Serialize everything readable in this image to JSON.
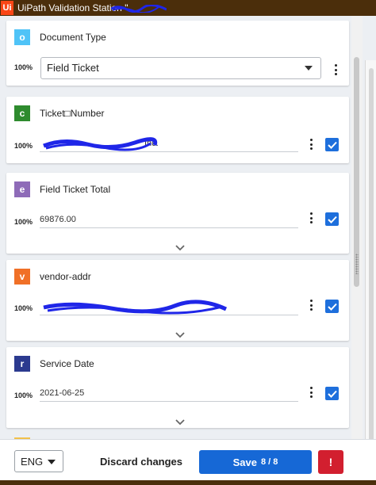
{
  "window": {
    "app_icon_text": "Ui",
    "title": "UiPath Validation Station \""
  },
  "fields": [
    {
      "badge": "o",
      "badge_color": "#4fc3f7",
      "name": "Document Type",
      "confidence": "100%",
      "value": "Field Ticket"
    },
    {
      "badge": "c",
      "badge_color": "#2e8b2e",
      "name": "Ticket□Number",
      "confidence": "100%",
      "value": "Inc."
    },
    {
      "badge": "e",
      "badge_color": "#8e6bb8",
      "name": "Field Ticket Total",
      "confidence": "100%",
      "value": "69876.00"
    },
    {
      "badge": "v",
      "badge_color": "#f07027",
      "name": "vendor-addr",
      "confidence": "100%",
      "value": ""
    },
    {
      "badge": "r",
      "badge_color": "#2b3a8f",
      "name": "Service Date",
      "confidence": "100%",
      "value": "2021-06-25"
    }
  ],
  "footer": {
    "language": "ENG",
    "discard_label": "Discard changes",
    "save_label": "Save",
    "save_count": "8 / 8",
    "alert_label": "!"
  },
  "colors": {
    "primary": "#1668d6",
    "danger": "#d21f2f",
    "titlebar": "#4b2e0b",
    "redaction": "#1f26e8"
  }
}
